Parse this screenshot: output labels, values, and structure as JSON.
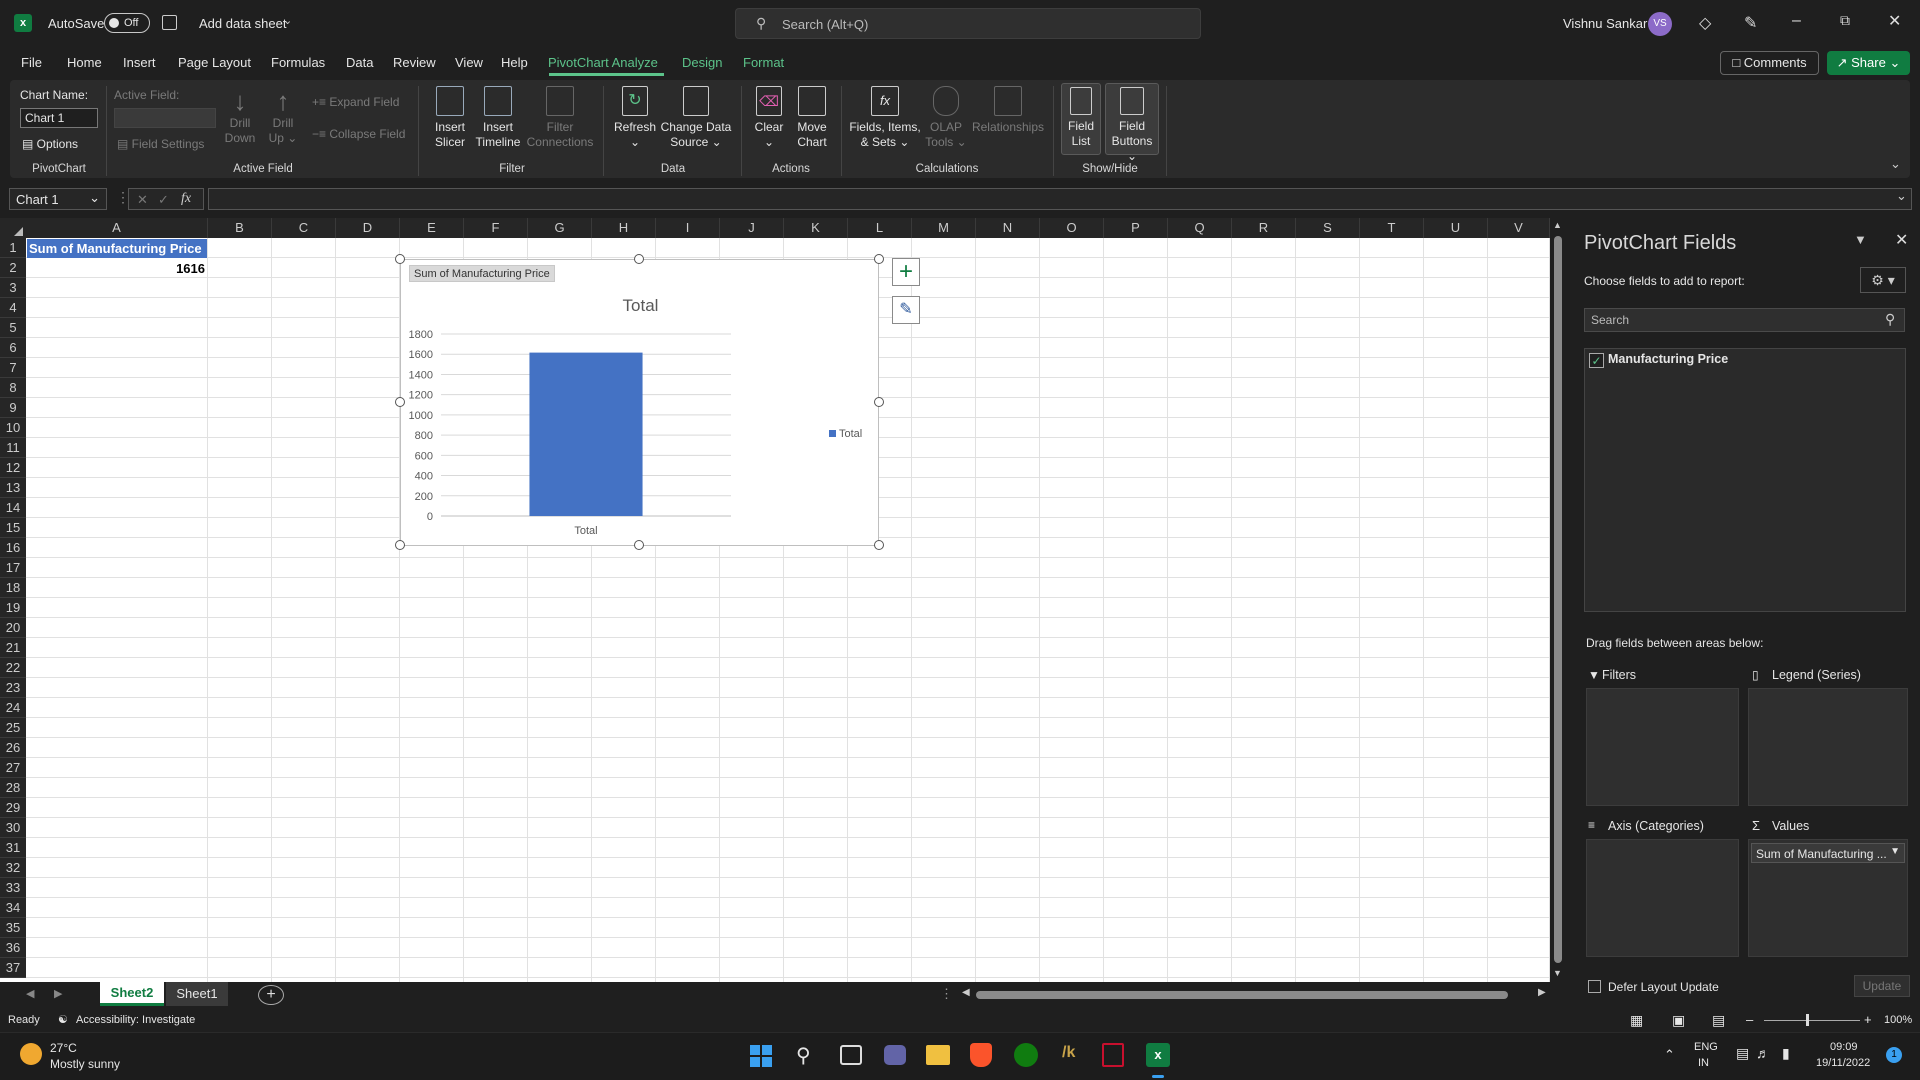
{
  "title_bar": {
    "autosave_label": "AutoSave",
    "autosave_state": "Off",
    "doc_title": "Add data sheet",
    "search_placeholder": "Search (Alt+Q)",
    "user_name": "Vishnu Sankar",
    "user_initials": "VS"
  },
  "tabs": [
    "File",
    "Home",
    "Insert",
    "Page Layout",
    "Formulas",
    "Data",
    "Review",
    "View",
    "Help",
    "PivotChart Analyze",
    "Design",
    "Format"
  ],
  "comments_label": "Comments",
  "share_label": "Share",
  "ribbon": {
    "chart_name_label": "Chart Name:",
    "chart_name_value": "Chart 1",
    "options_label": "Options",
    "group_pivotchart": "PivotChart",
    "active_field_label": "Active Field:",
    "drill_down": [
      "Drill",
      "Down"
    ],
    "drill_up": [
      "Drill",
      "Up"
    ],
    "expand_field": "Expand Field",
    "collapse_field": "Collapse Field",
    "field_settings": "Field Settings",
    "group_active_field": "Active Field",
    "insert_slicer": [
      "Insert",
      "Slicer"
    ],
    "insert_timeline": [
      "Insert",
      "Timeline"
    ],
    "filter_connections": [
      "Filter",
      "Connections"
    ],
    "group_filter": "Filter",
    "refresh": "Refresh",
    "change_data_source": [
      "Change Data",
      "Source"
    ],
    "group_data": "Data",
    "clear": "Clear",
    "move_chart": [
      "Move",
      "Chart"
    ],
    "group_actions": "Actions",
    "fields_items_sets": [
      "Fields, Items,",
      "& Sets"
    ],
    "olap_tools": [
      "OLAP",
      "Tools"
    ],
    "relationships": "Relationships",
    "group_calculations": "Calculations",
    "field_list": [
      "Field",
      "List"
    ],
    "field_buttons": [
      "Field",
      "Buttons"
    ],
    "group_showhide": "Show/Hide"
  },
  "formula_bar": {
    "name_box": "Chart 1",
    "fx": "fx",
    "formula": ""
  },
  "sheet": {
    "columns": [
      "A",
      "B",
      "C",
      "D",
      "E",
      "F",
      "G",
      "H",
      "I",
      "J",
      "K",
      "L",
      "M",
      "N",
      "O",
      "P",
      "Q",
      "R",
      "S",
      "T",
      "U",
      "V"
    ],
    "rows": [
      "1",
      "2",
      "3",
      "4",
      "5",
      "6",
      "7",
      "8",
      "9",
      "10",
      "11",
      "12",
      "13",
      "14",
      "15",
      "16",
      "17",
      "18",
      "19",
      "20",
      "21",
      "22",
      "23",
      "24",
      "25",
      "26",
      "27",
      "28",
      "29",
      "30",
      "31",
      "32",
      "33",
      "34",
      "35",
      "36",
      "37"
    ],
    "a1": "Sum of Manufacturing Price",
    "a2": "1616"
  },
  "chart_data": {
    "type": "bar",
    "field_button": "Sum of Manufacturing Price",
    "title": "Total",
    "categories": [
      "Total"
    ],
    "series": [
      {
        "name": "Total",
        "values": [
          1616
        ]
      }
    ],
    "ylim": [
      0,
      1800
    ],
    "yticks": [
      "1800",
      "1600",
      "1400",
      "1200",
      "1000",
      "800",
      "600",
      "400",
      "200",
      "0"
    ],
    "legend_position": "right",
    "bar_color": "#4472c4"
  },
  "pane": {
    "title": "PivotChart Fields",
    "choose_label": "Choose fields to add to report:",
    "search_placeholder": "Search",
    "field": "Manufacturing Price",
    "drag_label": "Drag fields between areas below:",
    "filters": "Filters",
    "legend": "Legend (Series)",
    "axis": "Axis (Categories)",
    "values": "Values",
    "values_item": "Sum of Manufacturing ...",
    "defer": "Defer Layout Update",
    "update": "Update"
  },
  "sheet_tabs": [
    "Sheet2",
    "Sheet1"
  ],
  "status": {
    "ready": "Ready",
    "accessibility": "Accessibility: Investigate",
    "zoom": "100%"
  },
  "taskbar": {
    "temp": "27°C",
    "weather": "Mostly sunny",
    "lang1": "ENG",
    "lang2": "IN",
    "time": "09:09",
    "date": "19/11/2022",
    "notif": "1"
  }
}
